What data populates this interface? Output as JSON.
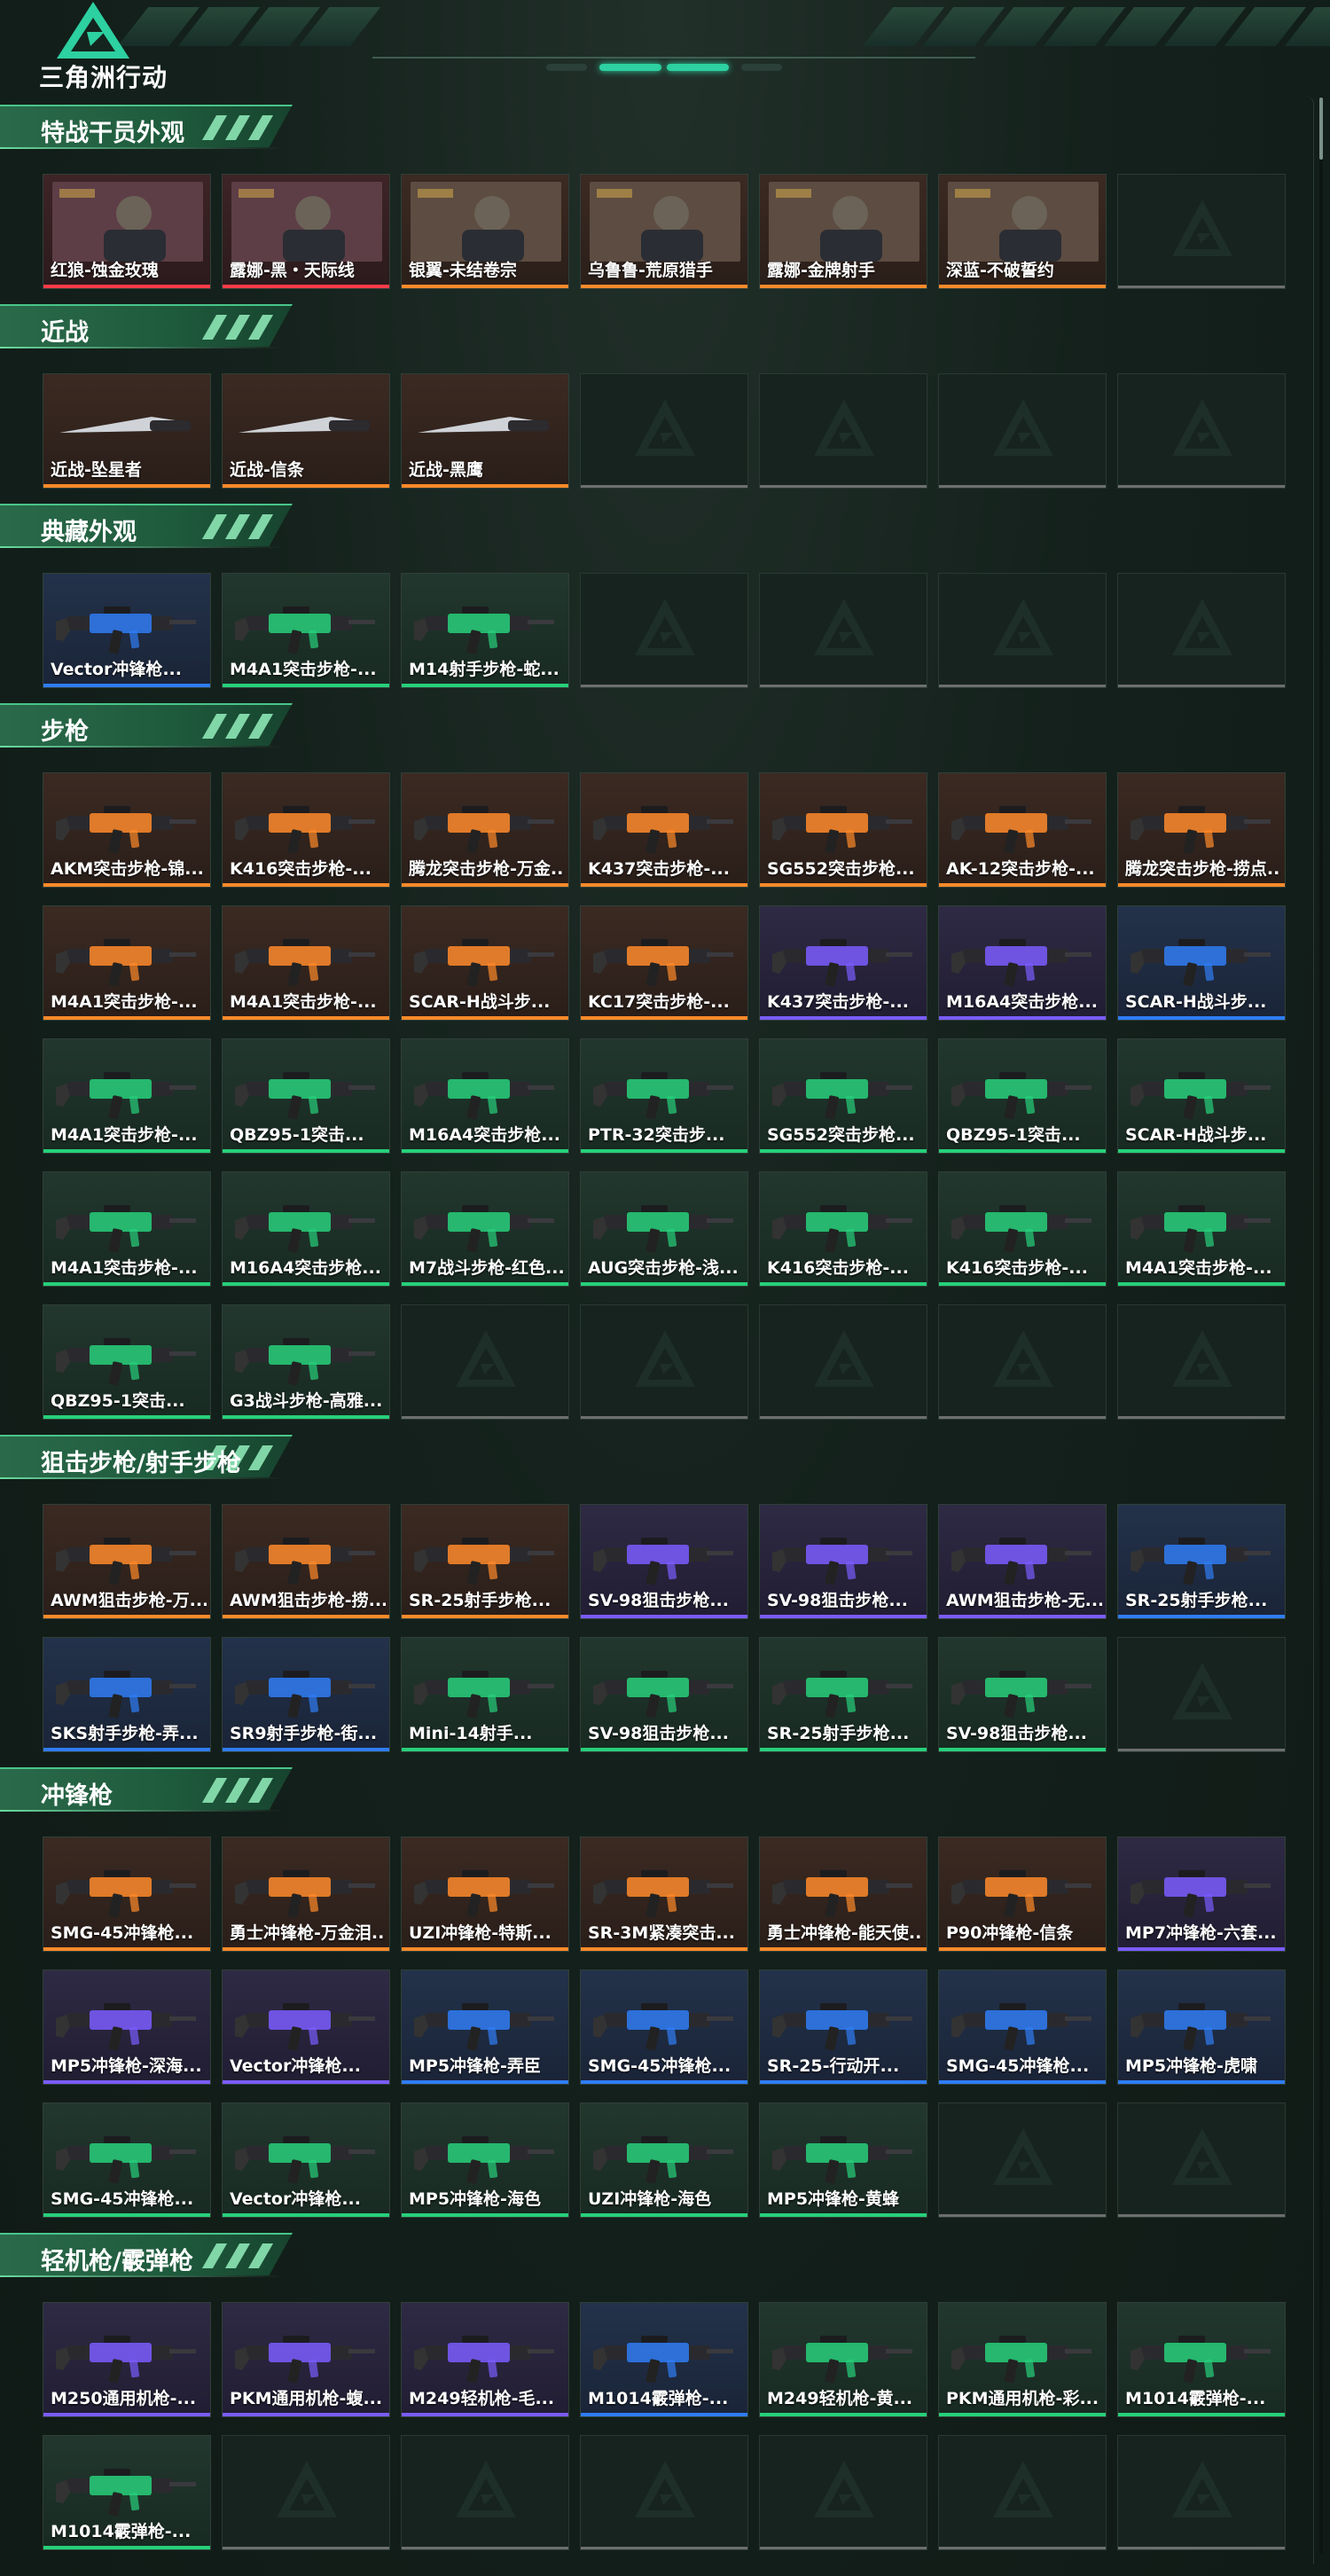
{
  "header": {
    "logo_text": "三角洲行动",
    "logo_icon": "delta-triangle-logo-icon"
  },
  "colors": {
    "orange": "#ff8a2a",
    "red": "#ff3b48",
    "purple": "#7a5cff",
    "blue": "#2f7df5",
    "green": "#27d07a",
    "empty": "#6c6f6e",
    "accent": "#2dd0a0"
  },
  "sections": [
    {
      "title": "特战干员外观",
      "kind": "operator",
      "slots": 7,
      "items": [
        {
          "label": "红狼-蚀金玫瑰",
          "rarity": "red"
        },
        {
          "label": "露娜-黑・天际线",
          "rarity": "red"
        },
        {
          "label": "银翼-未结卷宗",
          "rarity": "orange"
        },
        {
          "label": "乌鲁鲁-荒原猎手",
          "rarity": "orange"
        },
        {
          "label": "露娜-金牌射手",
          "rarity": "orange"
        },
        {
          "label": "深蓝-不破誓约",
          "rarity": "orange"
        }
      ]
    },
    {
      "title": "近战",
      "kind": "melee",
      "slots": 7,
      "items": [
        {
          "label": "近战-坠星者",
          "rarity": "orange"
        },
        {
          "label": "近战-信条",
          "rarity": "orange"
        },
        {
          "label": "近战-黑鹰",
          "rarity": "orange"
        }
      ]
    },
    {
      "title": "典藏外观",
      "kind": "gun",
      "slots": 7,
      "items": [
        {
          "label": "Vector冲锋枪...",
          "rarity": "blue"
        },
        {
          "label": "M4A1突击步枪-...",
          "rarity": "green"
        },
        {
          "label": "M14射手步枪-蛇...",
          "rarity": "green"
        }
      ]
    },
    {
      "title": "步枪",
      "kind": "gun",
      "slots": 35,
      "items": [
        {
          "label": "AKM突击步枪-锦...",
          "rarity": "orange"
        },
        {
          "label": "K416突击步枪-...",
          "rarity": "orange"
        },
        {
          "label": "腾龙突击步枪-万金...",
          "rarity": "orange"
        },
        {
          "label": "K437突击步枪-...",
          "rarity": "orange"
        },
        {
          "label": "SG552突击步枪...",
          "rarity": "orange"
        },
        {
          "label": "AK-12突击步枪-...",
          "rarity": "orange"
        },
        {
          "label": "腾龙突击步枪-捞点...",
          "rarity": "orange"
        },
        {
          "label": "M4A1突击步枪-...",
          "rarity": "orange"
        },
        {
          "label": "M4A1突击步枪-...",
          "rarity": "orange"
        },
        {
          "label": "SCAR-H战斗步...",
          "rarity": "orange"
        },
        {
          "label": "KC17突击步枪-...",
          "rarity": "orange"
        },
        {
          "label": "K437突击步枪-...",
          "rarity": "purple"
        },
        {
          "label": "M16A4突击步枪...",
          "rarity": "purple"
        },
        {
          "label": "SCAR-H战斗步...",
          "rarity": "blue"
        },
        {
          "label": "M4A1突击步枪-...",
          "rarity": "green"
        },
        {
          "label": "QBZ95-1突击...",
          "rarity": "green"
        },
        {
          "label": "M16A4突击步枪...",
          "rarity": "green"
        },
        {
          "label": "PTR-32突击步...",
          "rarity": "green"
        },
        {
          "label": "SG552突击步枪...",
          "rarity": "green"
        },
        {
          "label": "QBZ95-1突击...",
          "rarity": "green"
        },
        {
          "label": "SCAR-H战斗步...",
          "rarity": "green"
        },
        {
          "label": "M4A1突击步枪-...",
          "rarity": "green"
        },
        {
          "label": "M16A4突击步枪...",
          "rarity": "green"
        },
        {
          "label": "M7战斗步枪-红色...",
          "rarity": "green"
        },
        {
          "label": "AUG突击步枪-浅...",
          "rarity": "green"
        },
        {
          "label": "K416突击步枪-...",
          "rarity": "green"
        },
        {
          "label": "K416突击步枪-...",
          "rarity": "green"
        },
        {
          "label": "M4A1突击步枪-...",
          "rarity": "green"
        },
        {
          "label": "QBZ95-1突击...",
          "rarity": "green"
        },
        {
          "label": "G3战斗步枪-高雅...",
          "rarity": "green"
        }
      ]
    },
    {
      "title": "狙击步枪/射手步枪",
      "kind": "gun",
      "slots": 14,
      "items": [
        {
          "label": "AWM狙击步枪-万...",
          "rarity": "orange"
        },
        {
          "label": "AWM狙击步枪-捞...",
          "rarity": "orange"
        },
        {
          "label": "SR-25射手步枪...",
          "rarity": "orange"
        },
        {
          "label": "SV-98狙击步枪...",
          "rarity": "purple"
        },
        {
          "label": "SV-98狙击步枪...",
          "rarity": "purple"
        },
        {
          "label": "AWM狙击步枪-无...",
          "rarity": "purple"
        },
        {
          "label": "SR-25射手步枪...",
          "rarity": "blue"
        },
        {
          "label": "SKS射手步枪-弄...",
          "rarity": "blue"
        },
        {
          "label": "SR9射手步枪-街...",
          "rarity": "blue"
        },
        {
          "label": "Mini-14射手...",
          "rarity": "green"
        },
        {
          "label": "SV-98狙击步枪...",
          "rarity": "green"
        },
        {
          "label": "SR-25射手步枪...",
          "rarity": "green"
        },
        {
          "label": "SV-98狙击步枪...",
          "rarity": "green"
        }
      ]
    },
    {
      "title": "冲锋枪",
      "kind": "gun",
      "slots": 21,
      "items": [
        {
          "label": "SMG-45冲锋枪...",
          "rarity": "orange"
        },
        {
          "label": "勇士冲锋枪-万金泪...",
          "rarity": "orange"
        },
        {
          "label": "UZI冲锋枪-特斯...",
          "rarity": "orange"
        },
        {
          "label": "SR-3M紧凑突击...",
          "rarity": "orange"
        },
        {
          "label": "勇士冲锋枪-能天使...",
          "rarity": "orange"
        },
        {
          "label": "P90冲锋枪-信条",
          "rarity": "orange"
        },
        {
          "label": "MP7冲锋枪-六套...",
          "rarity": "purple"
        },
        {
          "label": "MP5冲锋枪-深海...",
          "rarity": "purple"
        },
        {
          "label": "Vector冲锋枪...",
          "rarity": "purple"
        },
        {
          "label": "MP5冲锋枪-弄臣",
          "rarity": "blue"
        },
        {
          "label": "SMG-45冲锋枪...",
          "rarity": "blue"
        },
        {
          "label": "SR-25-行动开...",
          "rarity": "blue"
        },
        {
          "label": "SMG-45冲锋枪...",
          "rarity": "blue"
        },
        {
          "label": "MP5冲锋枪-虎啸",
          "rarity": "blue"
        },
        {
          "label": "SMG-45冲锋枪...",
          "rarity": "green"
        },
        {
          "label": "Vector冲锋枪...",
          "rarity": "green"
        },
        {
          "label": "MP5冲锋枪-海色",
          "rarity": "green"
        },
        {
          "label": "UZI冲锋枪-海色",
          "rarity": "green"
        },
        {
          "label": "MP5冲锋枪-黄蜂",
          "rarity": "green"
        }
      ]
    },
    {
      "title": "轻机枪/霰弹枪",
      "kind": "gun",
      "slots": 14,
      "items": [
        {
          "label": "M250通用机枪-...",
          "rarity": "purple"
        },
        {
          "label": "PKM通用机枪-蝮...",
          "rarity": "purple"
        },
        {
          "label": "M249轻机枪-毛...",
          "rarity": "purple"
        },
        {
          "label": "M1014霰弹枪-...",
          "rarity": "blue"
        },
        {
          "label": "M249轻机枪-黄...",
          "rarity": "green"
        },
        {
          "label": "PKM通用机枪-彩...",
          "rarity": "green"
        },
        {
          "label": "M1014霰弹枪-...",
          "rarity": "green"
        },
        {
          "label": "M1014霰弹枪-...",
          "rarity": "green"
        }
      ]
    }
  ]
}
